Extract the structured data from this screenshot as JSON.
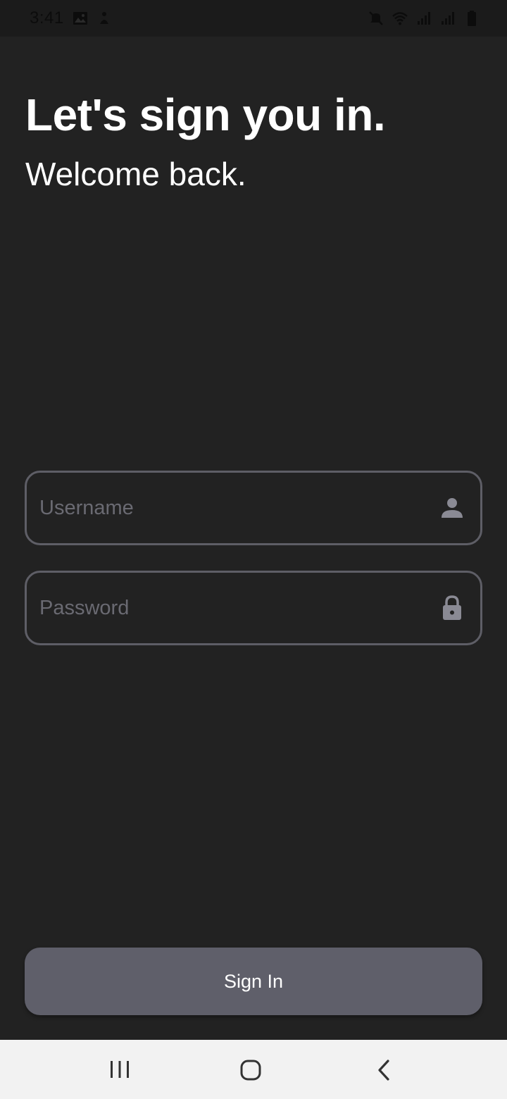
{
  "status_bar": {
    "time": "3:41",
    "left_icons": [
      "image-icon",
      "notification-icon"
    ],
    "right_icons": [
      "mute-icon",
      "wifi-icon",
      "signal-icon",
      "signal-icon",
      "battery-icon"
    ]
  },
  "header": {
    "title": "Let's sign you in.",
    "subtitle": "Welcome back."
  },
  "form": {
    "username": {
      "value": "",
      "placeholder": "Username",
      "icon": "person-icon"
    },
    "password": {
      "value": "",
      "placeholder": "Password",
      "icon": "lock-icon"
    },
    "submit_label": "Sign In"
  },
  "nav_bar": {
    "buttons": [
      "recents-icon",
      "home-icon",
      "back-icon"
    ]
  },
  "colors": {
    "background": "#222222",
    "field_border": "#5e5e66",
    "placeholder": "#6a6a72",
    "button": "#5f5f6a",
    "text": "#ffffff",
    "nav_bar": "#f2f2f2"
  }
}
